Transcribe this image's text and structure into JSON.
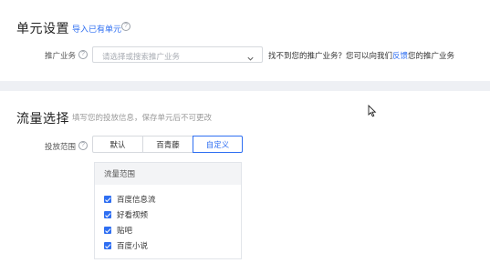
{
  "unit_settings": {
    "title": "单元设置",
    "import_link": "导入已有单元",
    "field_label": "推广业务",
    "select_placeholder": "请选择或搜索推广业务",
    "hint_before": "找不到您的推广业务？您可以向我们",
    "hint_link": "反馈",
    "hint_after": "您的推广业务"
  },
  "traffic": {
    "title": "流量选择",
    "subtitle": "填写您的投放信息，保存单元后不可更改",
    "field_label": "投放范围",
    "segments": [
      "默认",
      "百青藤",
      "自定义"
    ],
    "active_segment": "自定义",
    "panel_header": "流量范围",
    "options": [
      {
        "label": "百度信息流",
        "checked": true
      },
      {
        "label": "好看视频",
        "checked": true
      },
      {
        "label": "贴吧",
        "checked": true
      },
      {
        "label": "百度小说",
        "checked": true
      }
    ]
  },
  "colors": {
    "accent": "#2f6ff2",
    "background": "#eef0f4"
  }
}
